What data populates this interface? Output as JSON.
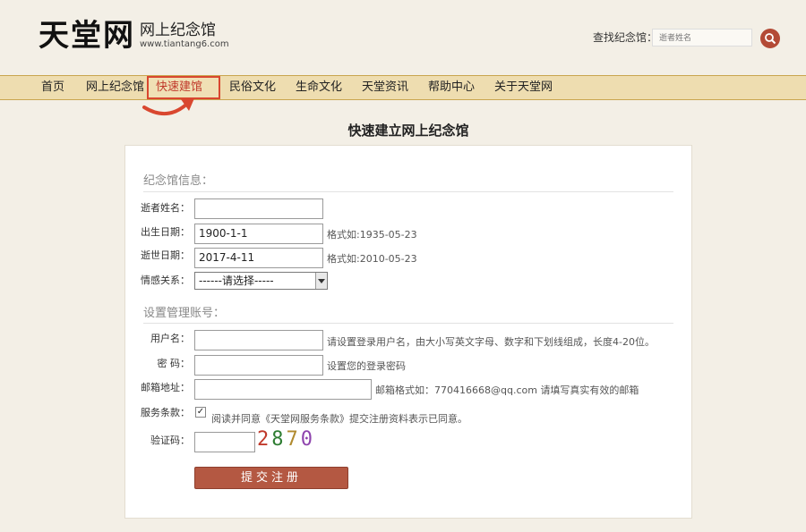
{
  "header": {
    "logo_text": "天堂网",
    "logo_subtitle": "网上纪念馆",
    "logo_url": "www.tiantang6.com",
    "search_label": "查找纪念馆：",
    "search_placeholder": "逝者姓名"
  },
  "nav": {
    "items": [
      {
        "label": "首页"
      },
      {
        "label": "网上纪念馆"
      },
      {
        "label": "快速建馆"
      },
      {
        "label": "民俗文化"
      },
      {
        "label": "生命文化"
      },
      {
        "label": "天堂资讯"
      },
      {
        "label": "帮助中心"
      },
      {
        "label": "关于天堂网"
      }
    ],
    "active_index": 2
  },
  "page": {
    "title": "快速建立网上纪念馆"
  },
  "memorial_section": {
    "title": "纪念馆信息：",
    "deceased_name_label": "逝者姓名：",
    "deceased_name_value": "",
    "birth_date_label": "出生日期：",
    "birth_date_value": "1900-1-1",
    "birth_date_hint": "格式如:1935-05-23",
    "death_date_label": "逝世日期：",
    "death_date_value": "2017-4-11",
    "death_date_hint": "格式如:2010-05-23",
    "relation_label": "情感关系：",
    "relation_selected": "------请选择-----"
  },
  "account_section": {
    "title": "设置管理账号：",
    "username_label": "用户名：",
    "username_hint": "请设置登录用户名，由大小写英文字母、数字和下划线组成，长度4-20位。",
    "password_label": "密  码：",
    "password_hint": "设置您的登录密码",
    "email_label": "邮箱地址：",
    "email_hint": "邮箱格式如：770416668@qq.com  请填写真实有效的邮箱",
    "terms_label": "服务条款：",
    "terms_checked": true,
    "terms_text": "阅读并同意《天堂网服务条款》提交注册资料表示已同意。",
    "captcha_label": "验证码：",
    "captcha_chars": [
      "2",
      "8",
      "7",
      "0"
    ],
    "captcha_colors": [
      "#c0392b",
      "#2e7d32",
      "#b08a2e",
      "#8e44ad"
    ]
  },
  "submit": {
    "label": "提交注册"
  },
  "colors": {
    "nav_bg": "#eeddb0",
    "accent": "#b45842",
    "active_nav": "#c0392b"
  }
}
